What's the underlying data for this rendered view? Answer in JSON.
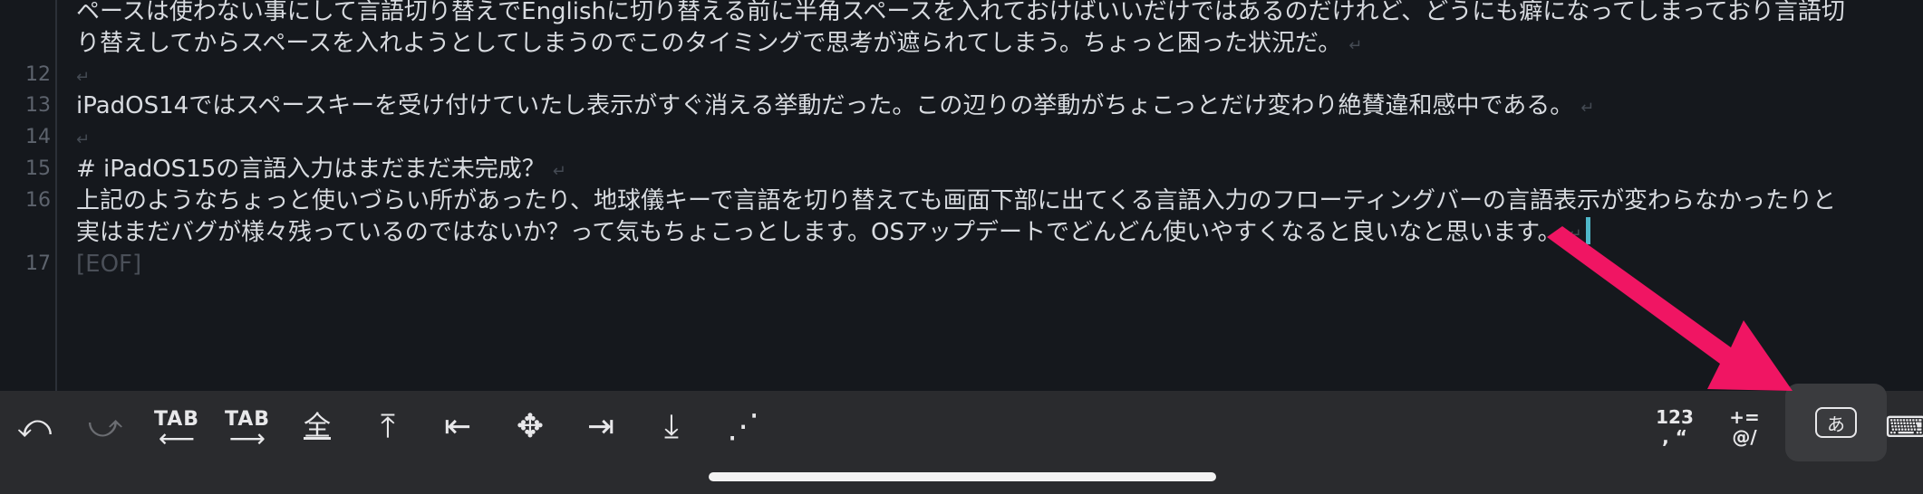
{
  "editor": {
    "lines": [
      {
        "num": "",
        "text": "ペースは使わない事にして言語切り替えでEnglishに切り替える前に半角スペースを入れておけばいいだけではあるのだけれど、どうにも癖になってしまっており言語切"
      },
      {
        "num": "",
        "text": "り替えしてからスペースを入れようとしてしまうのでこのタイミングで思考が遮られてしまう。ちょっと困った状況だ。"
      },
      {
        "num": "12",
        "text": ""
      },
      {
        "num": "13",
        "text": "iPadOS14ではスペースキーを受け付けていたし表示がすぐ消える挙動だった。この辺りの挙動がちょこっとだけ変わり絶賛違和感中である。"
      },
      {
        "num": "14",
        "text": ""
      },
      {
        "num": "15",
        "text": "# iPadOS15の言語入力はまだまだ未完成？"
      },
      {
        "num": "16",
        "text": "上記のようなちょっと使いづらい所があったり、地球儀キーで言語を切り替えても画面下部に出てくる言語入力のフローティングバーの言語表示が変わらなかったりと"
      },
      {
        "num": "",
        "text": "実はまだバグが様々残っているのではないか？って気もちょこっとします。OSアップデートでどんどん使いやすくなると良いなと思います。"
      },
      {
        "num": "17",
        "text": "[EOF]"
      }
    ],
    "return_mark": "↵"
  },
  "toolbar": {
    "undo": "⤺",
    "redo": "⤻",
    "tab_left_label": "TAB",
    "tab_left_arrow": "⟵",
    "tab_right_label": "TAB",
    "tab_right_arrow": "⟶",
    "select_all": "全",
    "to_top": "⤒",
    "to_line_start": "⇤",
    "cursor_move": "✥",
    "to_line_end": "⇥",
    "to_bottom": "⤓",
    "more": "⋰",
    "numbers_top": "123",
    "numbers_bottom": ", “",
    "symbols_top": "+=",
    "symbols_bottom": "@/",
    "kana": "あ",
    "keyboard": "⌨"
  },
  "colors": {
    "editor_bg": "#15181d",
    "toolbar_bg": "#2a2b2e",
    "cursor": "#4fb7c9",
    "arrow": "#f01563"
  }
}
